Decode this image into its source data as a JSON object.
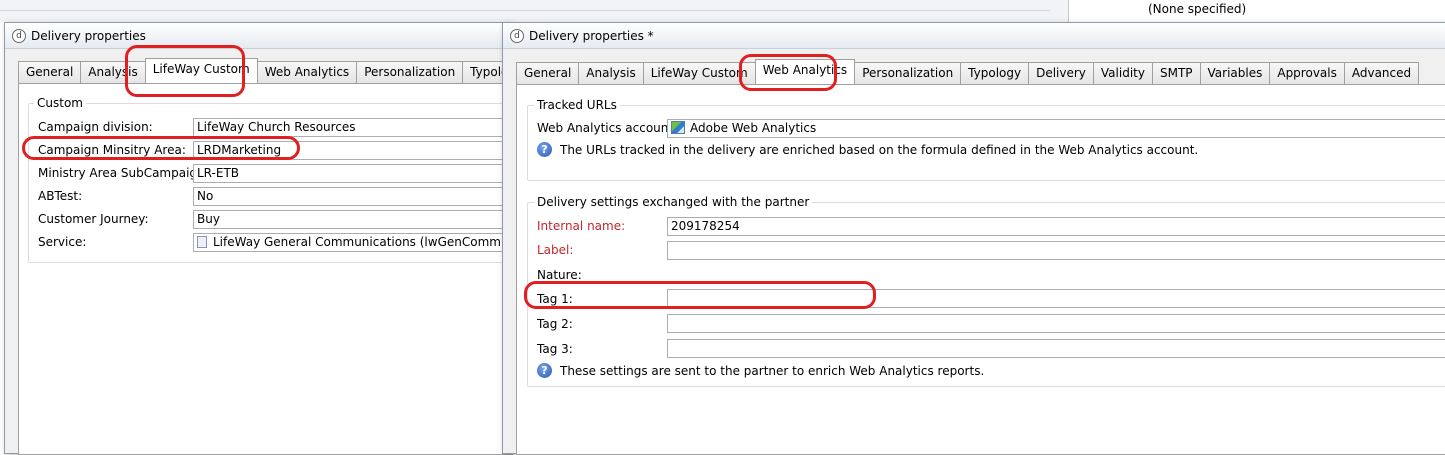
{
  "background": {
    "none_specified": "(None specified)"
  },
  "left_dialog": {
    "title": "Delivery properties",
    "tabs": [
      "General",
      "Analysis",
      "LifeWay Custom",
      "Web Analytics",
      "Personalization",
      "Typology"
    ],
    "group_title": "Custom",
    "fields": [
      {
        "label": "Campaign division:",
        "value": "LifeWay Church Resources"
      },
      {
        "label": "Campaign Minsitry Area:",
        "value": "LRDMarketing"
      },
      {
        "label": "Ministry Area SubCampaign:",
        "value": "LR-ETB"
      },
      {
        "label": "ABTest:",
        "value": "No"
      },
      {
        "label": "Customer Journey:",
        "value": "Buy"
      },
      {
        "label": "Service:",
        "value": "LifeWay General Communications (lwGenComm)"
      }
    ]
  },
  "right_dialog": {
    "title": "Delivery properties *",
    "tabs": [
      "General",
      "Analysis",
      "LifeWay Custom",
      "Web Analytics",
      "Personalization",
      "Typology",
      "Delivery",
      "Validity",
      "SMTP",
      "Variables",
      "Approvals",
      "Advanced"
    ],
    "tracked": {
      "group_title": "Tracked URLs",
      "account_label": "Web Analytics account:",
      "account_value": "Adobe Web Analytics",
      "info": "The URLs tracked in the delivery are enriched based on the formula defined in the Web Analytics account."
    },
    "settings": {
      "group_title": "Delivery settings exchanged with the partner",
      "fields": [
        {
          "label": "Internal name:",
          "value": "209178254"
        },
        {
          "label": "Label:",
          "value": ""
        },
        {
          "label": "Nature:",
          "value": ""
        },
        {
          "label": "Tag 1:",
          "value": ""
        },
        {
          "label": "Tag 2:",
          "value": ""
        },
        {
          "label": "Tag 3:",
          "value": ""
        }
      ],
      "info": "These settings are sent to the partner to enrich Web Analytics reports."
    }
  },
  "colors": {
    "annotation": "#e02020",
    "required_label": "#c0272d"
  }
}
